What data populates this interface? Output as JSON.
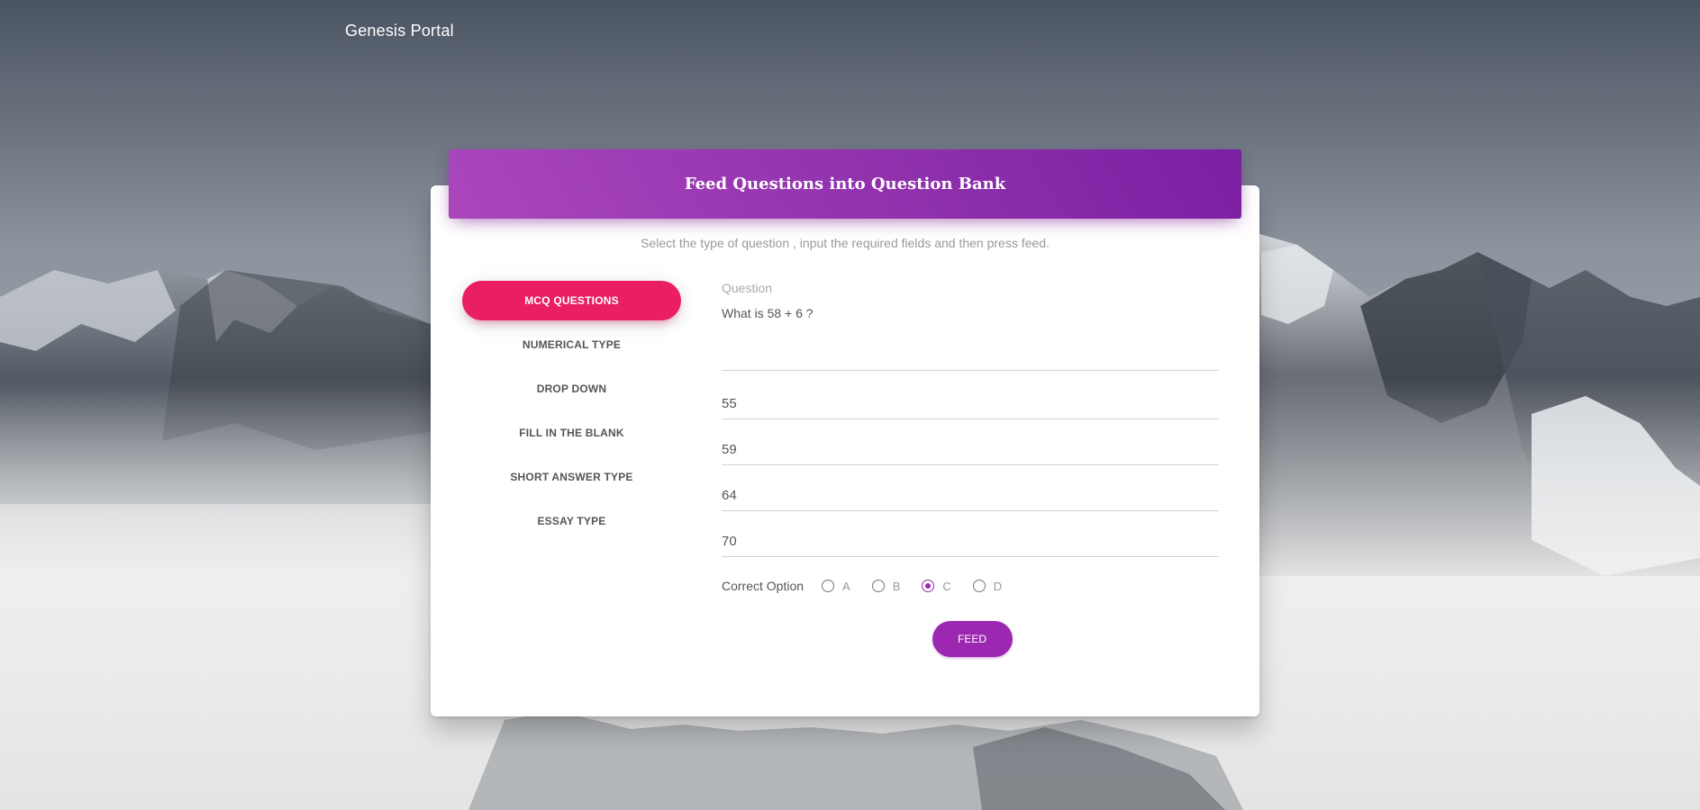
{
  "app": {
    "brand": "Genesis Portal"
  },
  "card": {
    "title": "Feed Questions into Question Bank",
    "subtitle": "Select the type of question , input the required fields and then press feed."
  },
  "tabs": [
    {
      "label": "MCQ QUESTIONS",
      "active": true
    },
    {
      "label": "NUMERICAL TYPE",
      "active": false
    },
    {
      "label": "DROP DOWN",
      "active": false
    },
    {
      "label": "FILL IN THE BLANK",
      "active": false
    },
    {
      "label": "SHORT ANSWER TYPE",
      "active": false
    },
    {
      "label": "ESSAY TYPE",
      "active": false
    }
  ],
  "form": {
    "question_label": "Question",
    "question_value": "What is 58 + 6 ?",
    "options": [
      "55",
      "59",
      "64",
      "70"
    ],
    "correct_option_label": "Correct Option",
    "radio_letters": [
      "A",
      "B",
      "C",
      "D"
    ],
    "selected_option": "C",
    "feed_label": "FEED"
  },
  "colors": {
    "header_gradient_start": "#ab47bc",
    "header_gradient_end": "#7b1fa2",
    "active_tab": "#e91e63",
    "feed_button": "#9c27b0",
    "radio_checked": "#9c27b0"
  }
}
